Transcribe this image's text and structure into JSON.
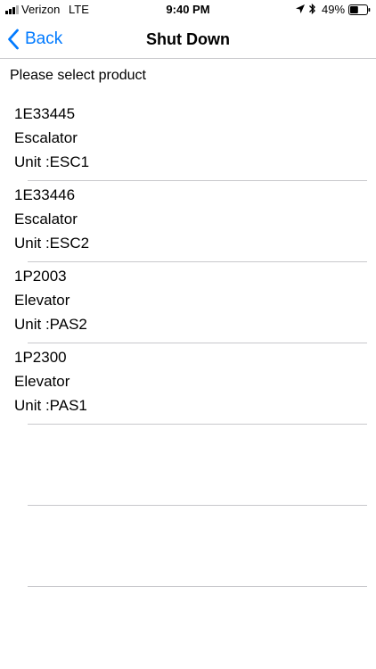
{
  "status_bar": {
    "carrier": "Verizon",
    "network": "LTE",
    "time": "9:40 PM",
    "battery": "49%",
    "battery_level": 0.49,
    "icons": [
      "signal-icon",
      "location-icon",
      "bluetooth-icon",
      "battery-icon"
    ]
  },
  "nav": {
    "back_label": "Back",
    "title": "Shut Down"
  },
  "prompt": "Please select product",
  "products": [
    {
      "id": "1E33445",
      "type": "Escalator",
      "unit": "Unit :ESC1"
    },
    {
      "id": "1E33446",
      "type": "Escalator",
      "unit": "Unit :ESC2"
    },
    {
      "id": "1P2003",
      "type": "Elevator",
      "unit": "Unit :PAS2"
    },
    {
      "id": "1P2300",
      "type": "Elevator",
      "unit": "Unit :PAS1"
    },
    {
      "id": "",
      "type": "",
      "unit": ""
    },
    {
      "id": "",
      "type": "",
      "unit": ""
    }
  ],
  "colors": {
    "accent": "#007aff",
    "separator": "#c8c8cc",
    "text": "#000000",
    "background": "#ffffff"
  }
}
